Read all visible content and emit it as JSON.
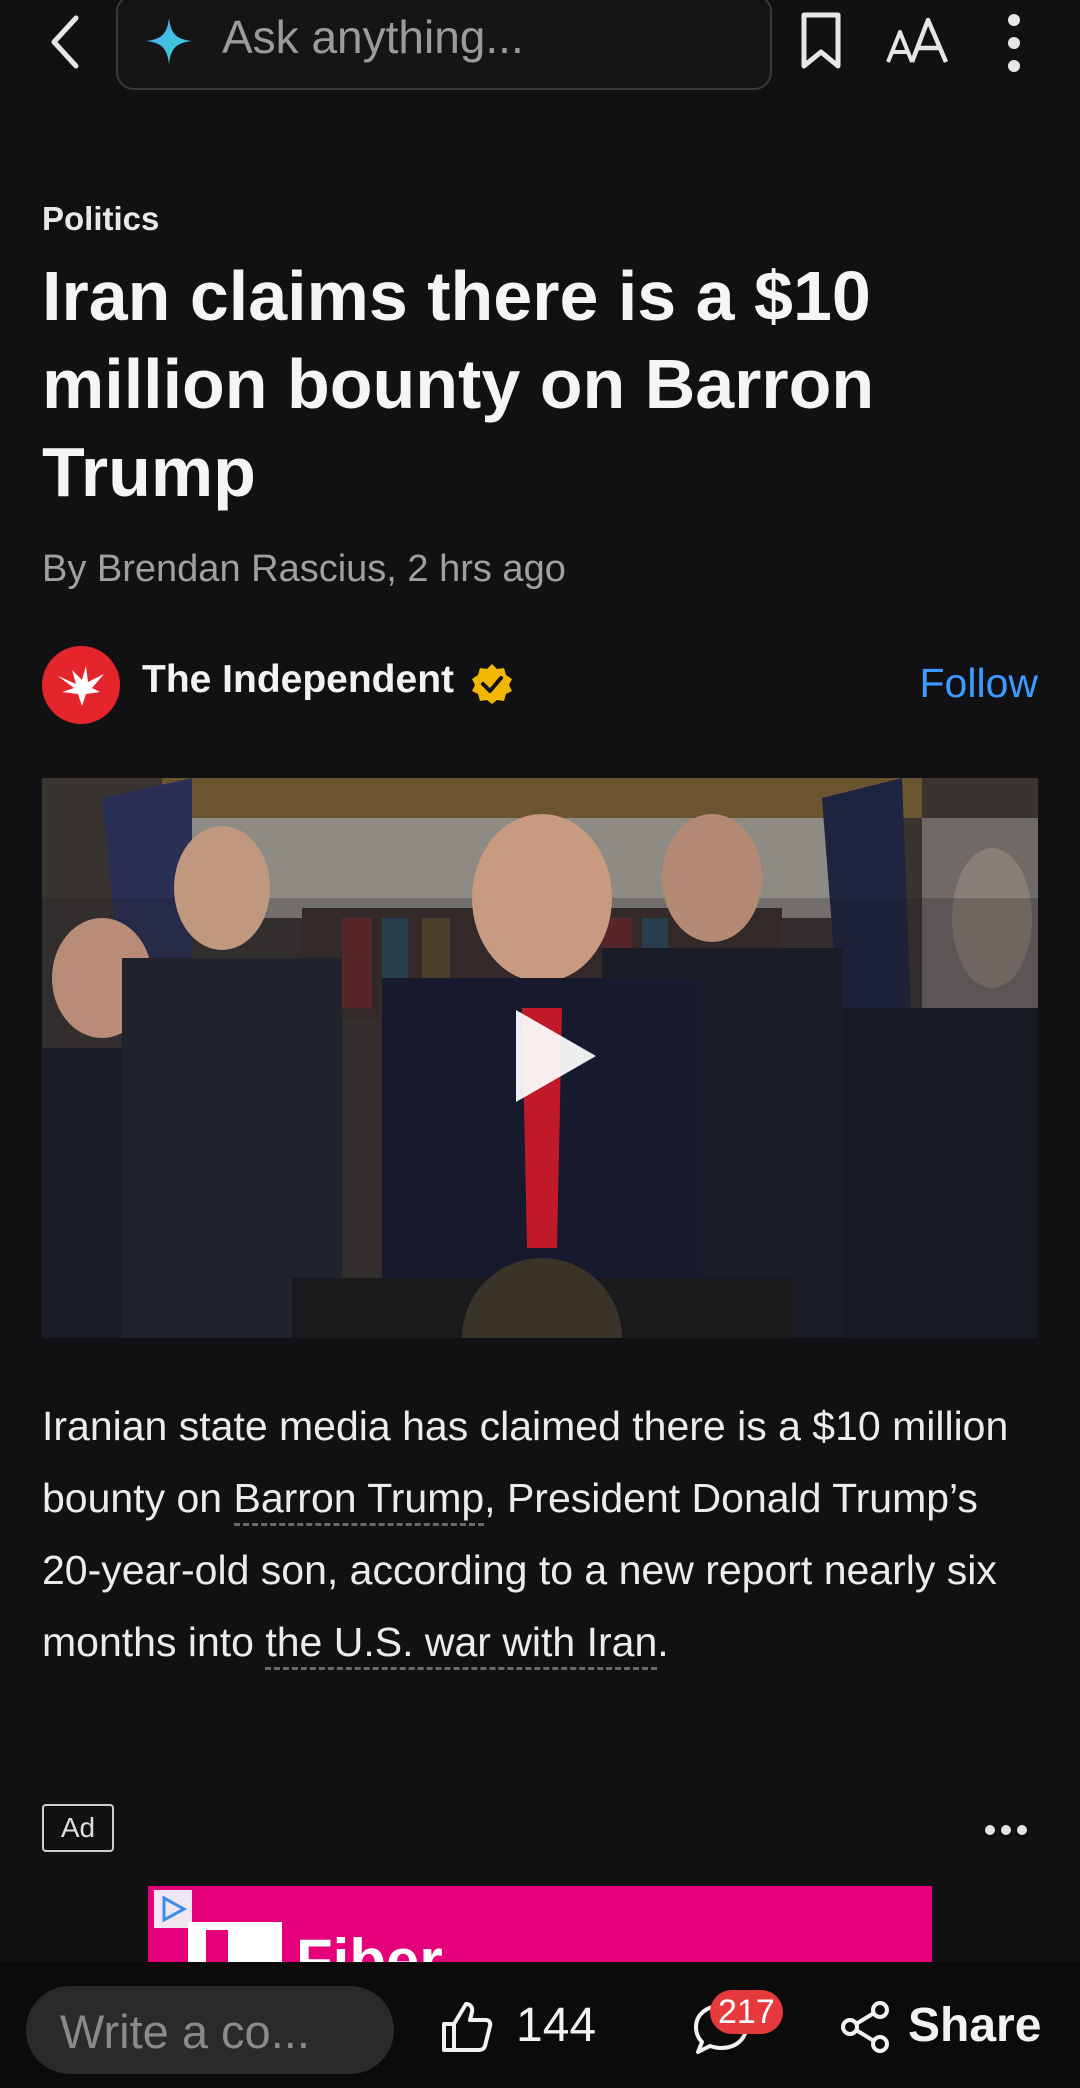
{
  "search": {
    "placeholder": "Ask anything..."
  },
  "article": {
    "category": "Politics",
    "headline": "Iran claims there is a $10 million bounty on Barron Trump",
    "byline": "By Brendan Rascius,  2 hrs ago",
    "source": {
      "name": "The Independent",
      "follow_label": "Follow"
    },
    "body": {
      "part1": "Iranian state media has claimed there is a $10 million bounty on ",
      "link1": "Barron Trump",
      "part2": ", President Donald Trump’s 20-year-old son, according to a new report nearly six months into ",
      "link2": "the U.S. war with Iran",
      "part3": "."
    }
  },
  "ad": {
    "badge": "Ad",
    "brand_text": "Fiber"
  },
  "bottom_bar": {
    "comment_placeholder": "Write a co...",
    "like_count": "144",
    "comment_count": "217",
    "share_label": "Share"
  },
  "colors": {
    "background": "#111113",
    "accent_follow": "#3b9bff",
    "verified_badge": "#f2b705",
    "source_logo": "#e4252c",
    "comment_badge": "#e5393b",
    "ad_background": "#e3007a"
  }
}
